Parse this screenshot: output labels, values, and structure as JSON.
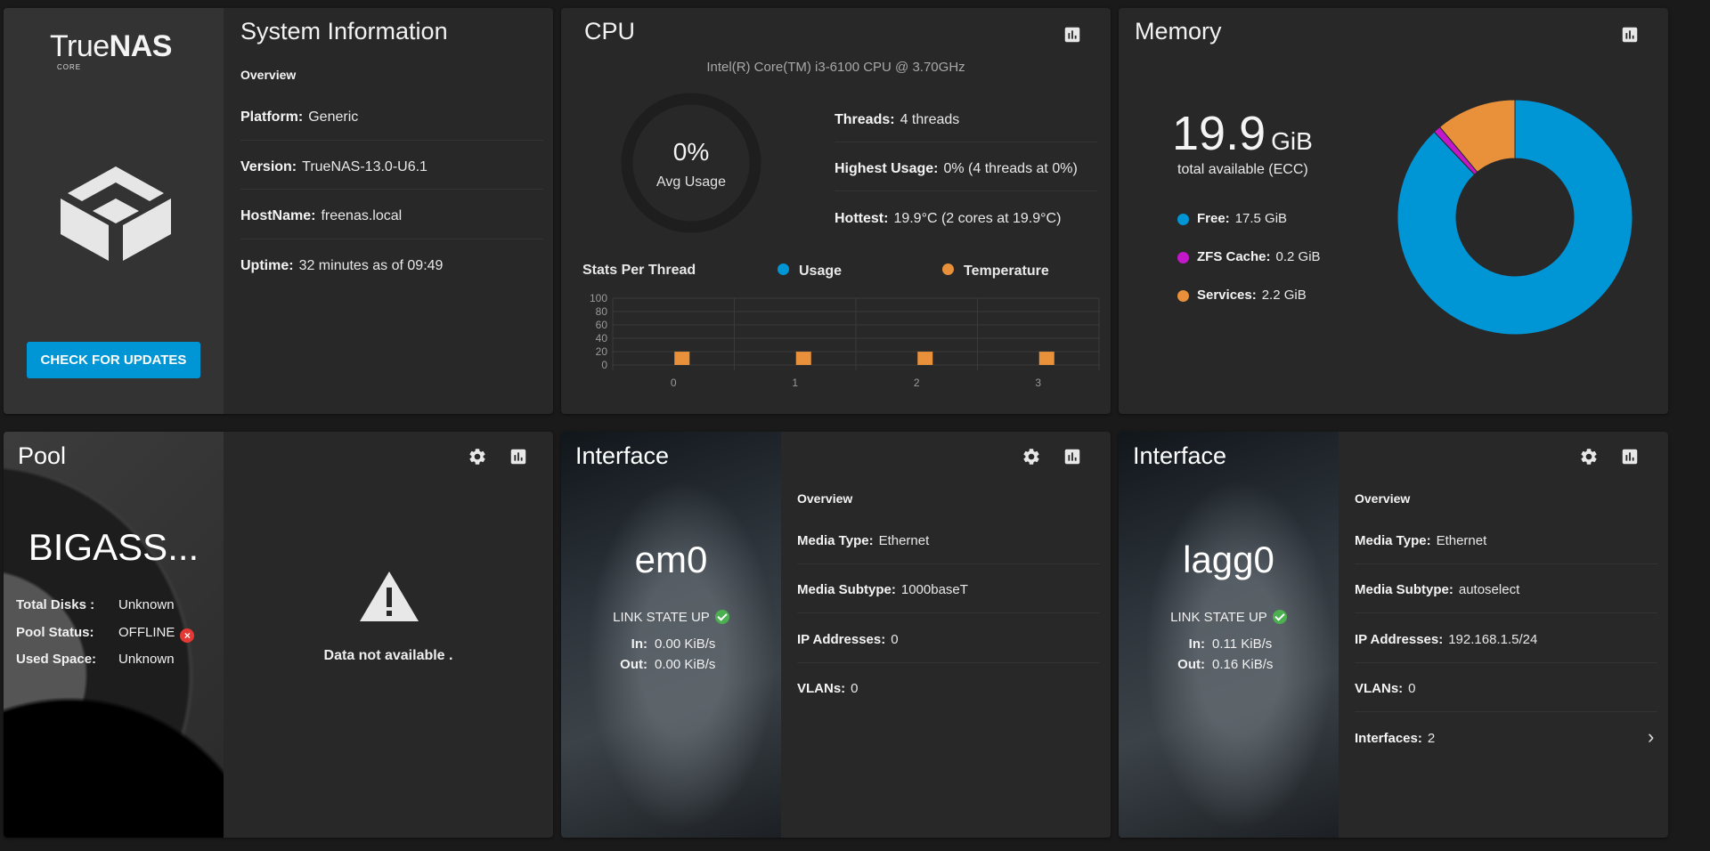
{
  "system": {
    "title": "System Information",
    "logo_true": "True",
    "logo_nas": "NAS",
    "logo_edition": "CORE",
    "overview": "Overview",
    "rows": [
      {
        "label": "Platform:",
        "value": "Generic"
      },
      {
        "label": "Version:",
        "value": "TrueNAS-13.0-U6.1"
      },
      {
        "label": "HostName:",
        "value": "freenas.local"
      },
      {
        "label": "Uptime:",
        "value": "32 minutes as of 09:49"
      }
    ],
    "update_button": "CHECK FOR UPDATES"
  },
  "cpu": {
    "title": "CPU",
    "model": "Intel(R) Core(TM) i3-6100 CPU @ 3.70GHz",
    "avg_value": "0%",
    "avg_label": "Avg Usage",
    "avg_fraction": 0,
    "rows": [
      {
        "label": "Threads:",
        "value": "4 threads"
      },
      {
        "label": "Highest Usage:",
        "value": "0%  (4 threads at 0%)"
      },
      {
        "label": "Hottest:",
        "value": "19.9°C  (2 cores at 19.9°C)"
      }
    ],
    "stats_label": "Stats Per Thread",
    "legend": [
      {
        "label": "Usage",
        "color": "#0095d5"
      },
      {
        "label": "Temperature",
        "color": "#e8913a"
      }
    ]
  },
  "chart_data": {
    "type": "bar",
    "categories": [
      "0",
      "1",
      "2",
      "3"
    ],
    "series": [
      {
        "name": "Usage",
        "values": [
          0,
          0,
          0,
          0
        ]
      },
      {
        "name": "Temperature",
        "values": [
          19.9,
          19.9,
          19.9,
          19.9
        ]
      }
    ],
    "y_ticks": [
      "100",
      "80",
      "60",
      "40",
      "20",
      "0"
    ],
    "ylim": [
      0,
      100
    ],
    "legend_position": "top-right"
  },
  "memory": {
    "title": "Memory",
    "total": "19.9",
    "unit": "GiB",
    "subtitle": "total available (ECC)",
    "segments": [
      {
        "label": "Free:",
        "value": "17.5 GiB",
        "amount": 17.5,
        "color": "#0095d5"
      },
      {
        "label": "ZFS Cache:",
        "value": "0.2 GiB",
        "amount": 0.2,
        "color": "#c218c9"
      },
      {
        "label": "Services:",
        "value": "2.2 GiB",
        "amount": 2.2,
        "color": "#e8913a"
      }
    ]
  },
  "pool": {
    "title": "Pool",
    "name": "BIGASS...",
    "rows": [
      {
        "label": "Total Disks :",
        "value": "Unknown"
      },
      {
        "label": "Pool Status:",
        "value": "OFFLINE"
      },
      {
        "label": "Used Space:",
        "value": "Unknown"
      }
    ],
    "not_available": "Data not available ."
  },
  "interfaces": [
    {
      "title": "Interface",
      "name": "em0",
      "link_state": "LINK STATE UP",
      "in_label": "In:",
      "in_value": "0.00 KiB/s",
      "out_label": "Out:",
      "out_value": "0.00 KiB/s",
      "overview": "Overview",
      "rows": [
        {
          "label": "Media Type:",
          "value": "Ethernet"
        },
        {
          "label": "Media Subtype:",
          "value": "1000baseT"
        },
        {
          "label": "IP Addresses:",
          "value": "0"
        },
        {
          "label": "VLANs:",
          "value": "0"
        }
      ]
    },
    {
      "title": "Interface",
      "name": "lagg0",
      "link_state": "LINK STATE UP",
      "in_label": "In:",
      "in_value": "0.11 KiB/s",
      "out_label": "Out:",
      "out_value": "0.16 KiB/s",
      "overview": "Overview",
      "rows": [
        {
          "label": "Media Type:",
          "value": "Ethernet"
        },
        {
          "label": "Media Subtype:",
          "value": "autoselect"
        },
        {
          "label": "IP Addresses:",
          "value": "192.168.1.5/24"
        },
        {
          "label": "VLANs:",
          "value": "0"
        },
        {
          "label": "Interfaces:",
          "value": "2"
        }
      ]
    }
  ]
}
